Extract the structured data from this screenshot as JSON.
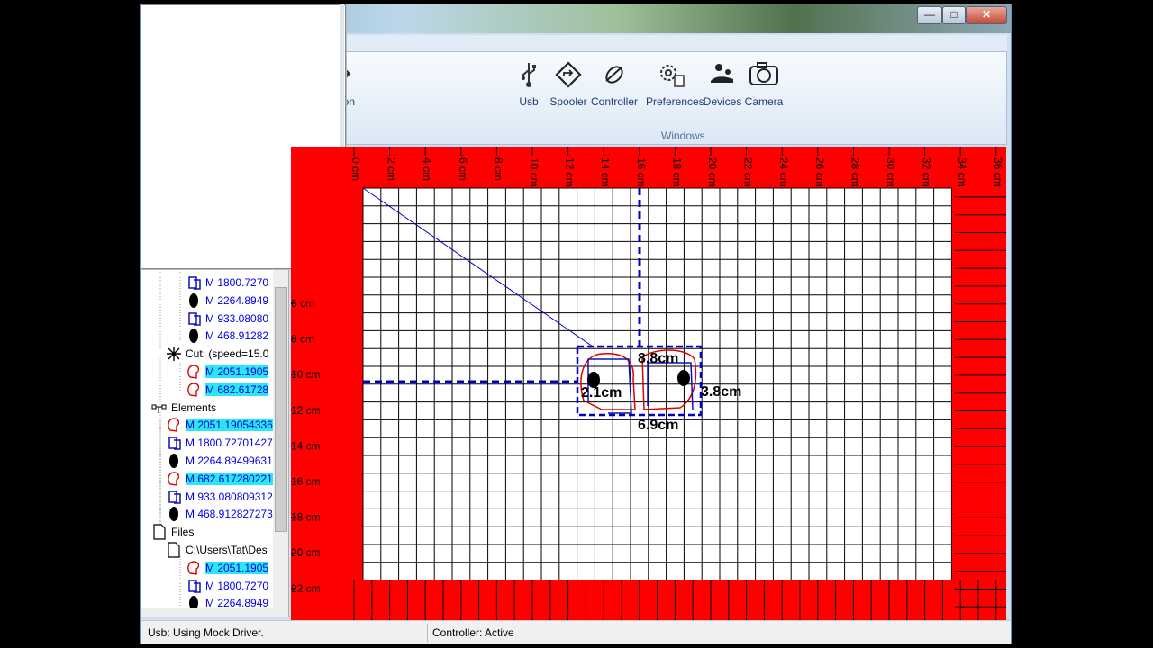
{
  "window": {
    "min_glyph": "—",
    "max_glyph": "□",
    "close_glyph": "✕"
  },
  "ribbon": {
    "buttons": [
      {
        "label": "ation",
        "icon": "navigation-icon"
      },
      {
        "label": "Usb",
        "icon": "usb-icon"
      },
      {
        "label": "Spooler",
        "icon": "spooler-icon"
      },
      {
        "label": "Controller",
        "icon": "controller-icon"
      },
      {
        "label": "Preferences",
        "icon": "preferences-icon"
      },
      {
        "label": "Devices",
        "icon": "devices-icon"
      },
      {
        "label": "Camera",
        "icon": "camera-icon"
      }
    ],
    "group_label": "Windows"
  },
  "tree": {
    "items": [
      {
        "text": "M 1800.7270",
        "icon": "blue-shape",
        "highlight": false
      },
      {
        "text": "M 2264.8949",
        "icon": "black-shape",
        "highlight": false
      },
      {
        "text": "M 933.08080",
        "icon": "blue-shape",
        "highlight": false
      },
      {
        "text": "M 468.91282",
        "icon": "black-shape",
        "highlight": false
      },
      {
        "text": "Cut: (speed=15.0",
        "icon": "cut-icon",
        "highlight": false,
        "plain": true
      },
      {
        "text": "M 2051.1905",
        "icon": "red-shape",
        "highlight": true
      },
      {
        "text": "M 682.61728",
        "icon": "red-shape",
        "highlight": true
      },
      {
        "text": "Elements",
        "icon": "elements-icon",
        "highlight": false,
        "plain": true
      },
      {
        "text": "M 2051.19054336",
        "icon": "red-shape",
        "highlight": true
      },
      {
        "text": "M 1800.72701427",
        "icon": "blue-shape",
        "highlight": false
      },
      {
        "text": "M 2264.89499631",
        "icon": "black-shape",
        "highlight": false
      },
      {
        "text": "M 682.617280221",
        "icon": "red-shape",
        "highlight": true
      },
      {
        "text": "M 933.080809312",
        "icon": "blue-shape",
        "highlight": false
      },
      {
        "text": "M 468.912827273",
        "icon": "black-shape",
        "highlight": false
      },
      {
        "text": "Files",
        "icon": "file-icon",
        "highlight": false,
        "plain": true
      },
      {
        "text": "C:\\Users\\Tat\\Des",
        "icon": "file-icon",
        "highlight": false,
        "plain": true
      },
      {
        "text": "M 2051.1905",
        "icon": "red-shape",
        "highlight": true
      },
      {
        "text": "M 1800.7270",
        "icon": "blue-shape",
        "highlight": false
      },
      {
        "text": "M 2264.8949",
        "icon": "black-shape",
        "highlight": false
      }
    ]
  },
  "canvas": {
    "top_ruler": [
      "0 cm",
      "2 cm",
      "4 cm",
      "6 cm",
      "8 cm",
      "10 cm",
      "12 cm",
      "14 cm",
      "16 cm",
      "18 cm",
      "20 cm",
      "22 cm",
      "24 cm",
      "26 cm",
      "28 cm",
      "30 cm",
      "32 cm",
      "34 cm",
      "36 cm"
    ],
    "left_ruler": [
      "6 cm",
      "8 cm",
      "10 cm",
      "12 cm",
      "14 cm",
      "16 cm",
      "18 cm",
      "20 cm",
      "22 cm"
    ],
    "dimensions": {
      "top": "8.8cm",
      "left": "2.1cm",
      "right": "3.8cm",
      "bottom": "6.9cm"
    },
    "colors": {
      "background": "#ff0000",
      "bed": "#ffffff",
      "grid": "#000000",
      "guides": "#0000cc",
      "shape_red": "#dd0000",
      "shape_blue": "#1010c0"
    }
  },
  "status": {
    "left": "Usb: Using Mock Driver.",
    "right": "Controller: Active"
  }
}
